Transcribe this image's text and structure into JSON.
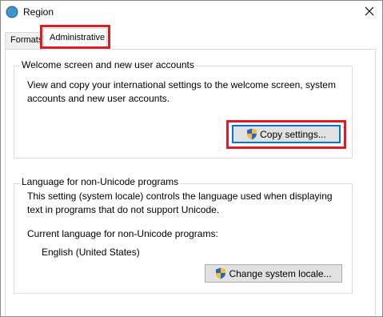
{
  "window": {
    "title": "Region",
    "close_glyph": "✕"
  },
  "tabs": [
    {
      "label": "Formats",
      "selected": false
    },
    {
      "label": "Administrative",
      "selected": true
    }
  ],
  "welcome_group": {
    "legend": "Welcome screen and new user accounts",
    "description": "View and copy your international settings to the welcome screen, system accounts and new user accounts.",
    "copy_button_label": "Copy settings..."
  },
  "locale_group": {
    "legend": "Language for non-Unicode programs",
    "description": "This setting (system locale) controls the language used when displaying text in programs that do not support Unicode.",
    "current_label": "Current language for non-Unicode programs:",
    "current_value": "English (United States)",
    "change_button_label": "Change system locale..."
  },
  "icons": {
    "app": "globe-icon",
    "close": "close-icon",
    "uac": "uac-shield-icon"
  },
  "colors": {
    "highlight": "#e01b24",
    "focus_border": "#0078d7",
    "button_face": "#e1e1e1"
  }
}
